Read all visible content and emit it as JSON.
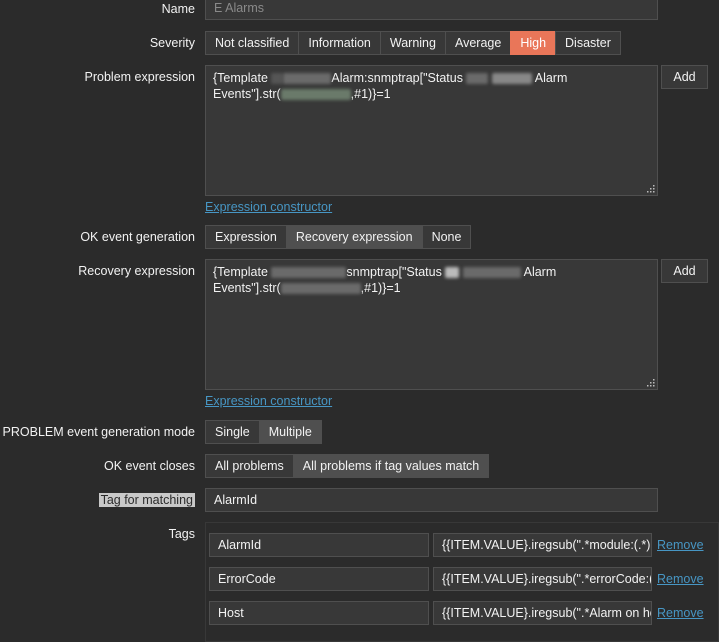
{
  "form": {
    "name": {
      "label": "Name",
      "value": "E Alarms"
    },
    "severity": {
      "label": "Severity",
      "options": [
        "Not classified",
        "Information",
        "Warning",
        "Average",
        "High",
        "Disaster"
      ],
      "selected": "High",
      "selected_color": "#e97659"
    },
    "problem_expression": {
      "label": "Problem expression",
      "line1": "{Template",
      "line1b": "Alarm:snmptrap[\"Status",
      "line1c": "Alarm",
      "line2": "Events\"].str(",
      "line2b": ",#1)}=1",
      "add_label": "Add",
      "constructor_link": "Expression constructor"
    },
    "ok_event_generation": {
      "label": "OK event generation",
      "options": [
        "Expression",
        "Recovery expression",
        "None"
      ],
      "selected": "Recovery expression"
    },
    "recovery_expression": {
      "label": "Recovery expression",
      "line1": "{Template",
      "line1b": "snmptrap[\"Status",
      "line1c": "Alarm",
      "line2": "Events\"].str(",
      "line2b": ",#1)}=1",
      "add_label": "Add",
      "constructor_link": "Expression constructor"
    },
    "problem_mode": {
      "label": "PROBLEM event generation mode",
      "options": [
        "Single",
        "Multiple"
      ],
      "selected": "Multiple"
    },
    "ok_event_closes": {
      "label": "OK event closes",
      "options": [
        "All problems",
        "All problems if tag values match"
      ],
      "selected": "All problems if tag values match"
    },
    "tag_for_matching": {
      "label": "Tag for matching",
      "value": "AlarmId"
    },
    "tags": {
      "label": "Tags",
      "remove_label": "Remove",
      "rows": [
        {
          "name": "AlarmId",
          "value": "{{ITEM.VALUE}.iregsub(\".*module:(.*),"
        },
        {
          "name": "ErrorCode",
          "value": "{{ITEM.VALUE}.iregsub(\".*errorCode:(["
        },
        {
          "name": "Host",
          "value": "{{ITEM.VALUE}.iregsub(\".*Alarm on ho"
        }
      ]
    }
  },
  "colors": {
    "accent_link": "#4796c4",
    "high": "#e97659"
  }
}
